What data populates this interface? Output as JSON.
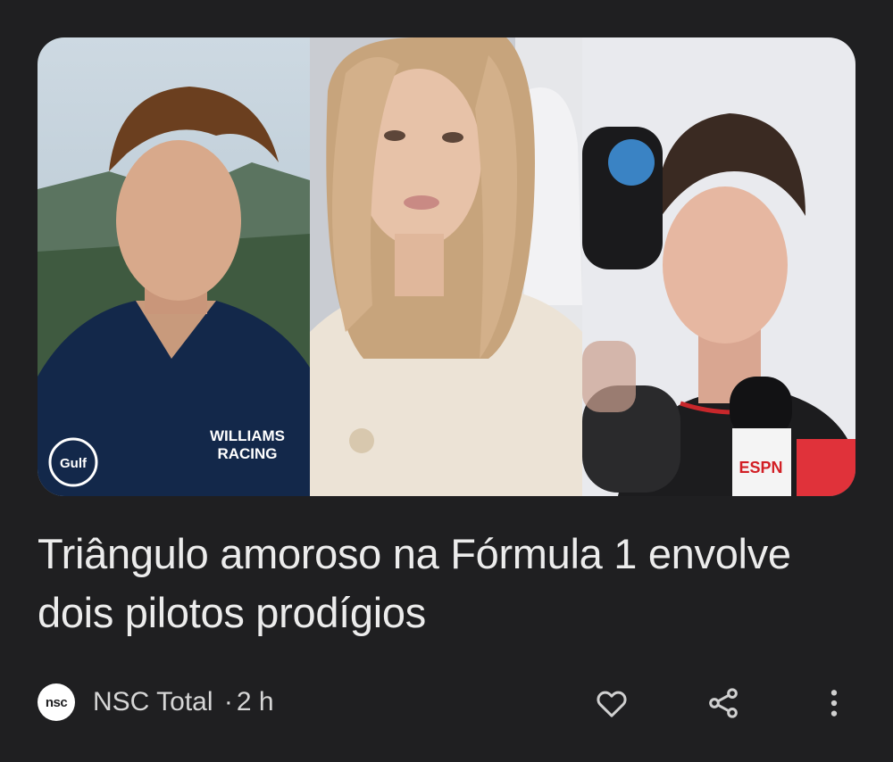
{
  "article": {
    "headline": "Triângulo amoroso na Fórmula 1 envolve dois pilotos prodígios",
    "source": {
      "logo_text": "nsc",
      "name": "NSC Total",
      "separator": "·",
      "time": "2 h"
    },
    "images": [
      {
        "jersey_text_1": "WILLIAMS",
        "jersey_text_2": "RACING",
        "badge_text": "Gulf"
      },
      {},
      {
        "mic_text": "ESPN"
      }
    ],
    "actions": {
      "like_icon": "heart-icon",
      "share_icon": "share-icon",
      "more_icon": "more-vert-icon"
    }
  },
  "colors": {
    "background": "#1f1f21",
    "headline": "#ececec",
    "meta": "#d6d6d6",
    "icon": "#d0d0d0"
  }
}
